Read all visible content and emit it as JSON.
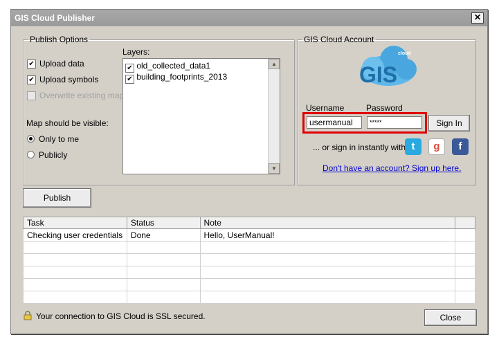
{
  "window": {
    "title": "GIS Cloud Publisher",
    "close_glyph": "✕"
  },
  "publish_options": {
    "legend": "Publish Options",
    "upload_data": {
      "label": "Upload data",
      "checked": true
    },
    "upload_symbols": {
      "label": "Upload symbols",
      "checked": true
    },
    "overwrite": {
      "label": "Overwrite existing map",
      "checked": false,
      "disabled": true
    },
    "visibility_label": "Map should be visible:",
    "visibility_options": [
      {
        "label": "Only to me",
        "selected": true
      },
      {
        "label": "Publicly",
        "selected": false
      }
    ],
    "layers_label": "Layers:",
    "layers": [
      {
        "name": "old_collected_data1",
        "checked": true
      },
      {
        "name": "building_footprints_2013",
        "checked": true
      }
    ]
  },
  "account": {
    "legend": "GIS Cloud Account",
    "logo_text": "GIS",
    "logo_small": "cloud",
    "username_label": "Username",
    "password_label": "Password",
    "username_value": "usermanual",
    "password_value": "*****",
    "sign_in_label": "Sign In",
    "social_prefix": "... or  sign in instantly with",
    "signup_link": "Don't have an account? Sign up here."
  },
  "publish_button": "Publish",
  "task_table": {
    "columns": [
      "Task",
      "Status",
      "Note"
    ],
    "rows": [
      [
        "Checking user credentials",
        "Done",
        "Hello, UserManual!"
      ]
    ]
  },
  "footer": {
    "ssl_text": "Your connection to GIS Cloud is SSL secured.",
    "close_label": "Close"
  },
  "colors": {
    "title_bar": "#9e9e9e",
    "highlight": "#e00000",
    "link": "#0000cc",
    "twitter": "#2aa9e0",
    "facebook": "#3b5998"
  },
  "icons": {
    "lock": "lock-icon",
    "twitter": "twitter-icon",
    "google": "google-icon",
    "facebook": "facebook-icon"
  }
}
